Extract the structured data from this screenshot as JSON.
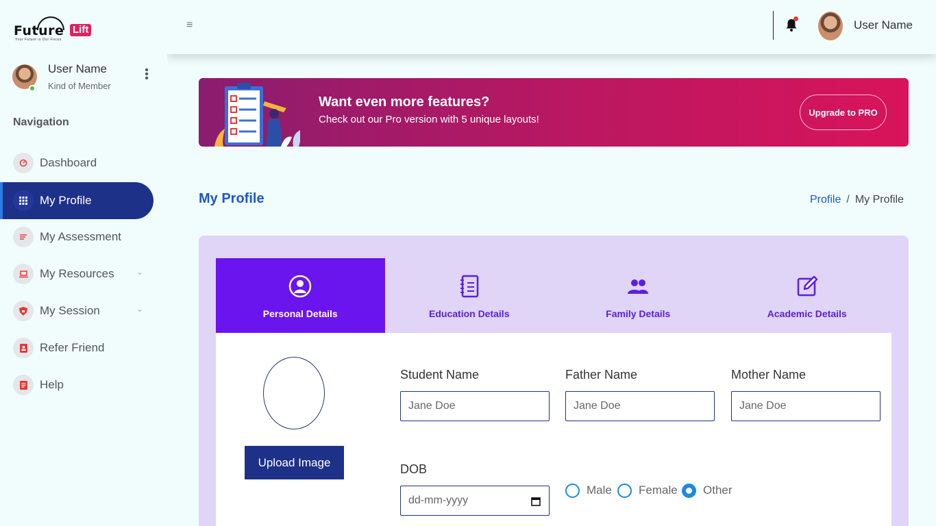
{
  "brand": {
    "word1": "Future",
    "word2": "Lift",
    "tagline": "Your Future is Our Focus"
  },
  "sidebar": {
    "user_name": "User Name",
    "user_role": "Kind of Member",
    "nav_heading": "Navigation",
    "items": [
      {
        "label": "Dashboard",
        "icon": "speedometer-icon"
      },
      {
        "label": "My Profile",
        "icon": "grid-icon"
      },
      {
        "label": "My Assessment",
        "icon": "list-icon"
      },
      {
        "label": "My Resources",
        "icon": "laptop-icon"
      },
      {
        "label": "My Session",
        "icon": "shield-icon"
      },
      {
        "label": "Refer Friend",
        "icon": "contact-card-icon"
      },
      {
        "label": "Help",
        "icon": "document-icon"
      }
    ]
  },
  "header": {
    "user_name": "User Name"
  },
  "promo": {
    "title": "Want even more features?",
    "subtitle": "Check out our Pro version with 5 unique layouts!",
    "button": "Upgrade to PRO"
  },
  "page": {
    "title": "My Profile",
    "breadcrumb": [
      "Profile",
      "My Profile"
    ],
    "breadcrumb_sep": "/"
  },
  "tabs": [
    {
      "label": "Personal Details",
      "icon": "user-circle-icon"
    },
    {
      "label": "Education Details",
      "icon": "notebook-icon"
    },
    {
      "label": "Family Details",
      "icon": "users-icon"
    },
    {
      "label": "Academic Details",
      "icon": "edit-icon"
    }
  ],
  "form": {
    "upload_button": "Upload Image",
    "student_label": "Student Name",
    "student_placeholder": "Jane Doe",
    "father_label": "Father Name",
    "father_placeholder": "Jane Doe",
    "mother_label": "Mother Name",
    "mother_placeholder": "Jane Doe",
    "dob_label": "DOB",
    "dob_placeholder": "dd-mm-yyyy",
    "gender_options": [
      "Male",
      "Female",
      "Other"
    ],
    "gender_selected": "Other"
  },
  "colors": {
    "primary": "#1e3188",
    "accent": "#6a14ee",
    "promo_start": "#8a1d6e",
    "promo_end": "#d8145a",
    "link": "#1e56c9"
  }
}
